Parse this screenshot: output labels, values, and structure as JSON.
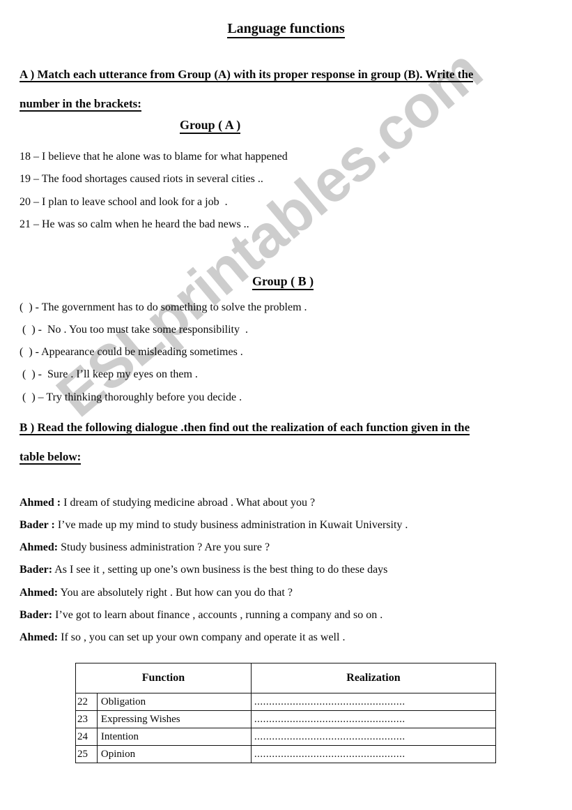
{
  "document": {
    "title": "Language functions ",
    "watermark": "ESLprintables.com"
  },
  "section_a": {
    "heading_line1": "A ) Match each utterance from Group (A) with its proper response in group (B). Write the",
    "heading_line2": "number in the brackets: ",
    "group_a_label": "Group ( A )",
    "group_a_items": [
      "18 – I believe that he alone was to blame for what happened",
      "19 – The food shortages caused riots in several cities ..",
      "20 – I plan to leave school and look for a job  .",
      "21 – He was so calm when he heard the bad news .."
    ],
    "group_b_label": "Group ( B )",
    "group_b_items": [
      "(  ) - The government has to do something to solve the problem .",
      " (  ) -  No . You too must take some responsibility  .",
      "(  ) - Appearance could be misleading sometimes .",
      " (  ) -  Sure . I’ll keep my eyes on them .",
      " (  ) – Try thinking thoroughly before you decide ."
    ]
  },
  "section_b": {
    "heading_line1": "B ) Read the following dialogue .then find out the realization of each function given in the",
    "heading_line2": "table below:",
    "dialogue": [
      {
        "speaker": "Ahmed :",
        "text": " I dream of studying medicine abroad . What about you ?"
      },
      {
        "speaker": "Bader :",
        "text": " I’ve made up my mind to study business administration in Kuwait University ."
      },
      {
        "speaker": "Ahmed:",
        "text": " Study business administration ? Are you sure ?"
      },
      {
        "speaker": "Bader:",
        "text": " As I see it , setting up one’s own business is the best thing to do these days"
      },
      {
        "speaker": "Ahmed:",
        "text": " You are absolutely right . But how can you do that ?"
      },
      {
        "speaker": "Bader:",
        "text": " I’ve got to learn about finance , accounts , running a company and so on ."
      },
      {
        "speaker": "Ahmed:",
        "text": " If so , you can set up your own company and operate it as well ."
      }
    ],
    "table": {
      "headers": [
        "Function",
        "Realization"
      ],
      "rows": [
        {
          "num": "22",
          "function": "Obligation",
          "realization": "..................................................."
        },
        {
          "num": "23",
          "function": "Expressing Wishes",
          "realization": "..................................................."
        },
        {
          "num": "24",
          "function": "Intention",
          "realization": "..................................................."
        },
        {
          "num": "25",
          "function": "Opinion",
          "realization": "..................................................."
        }
      ]
    }
  }
}
